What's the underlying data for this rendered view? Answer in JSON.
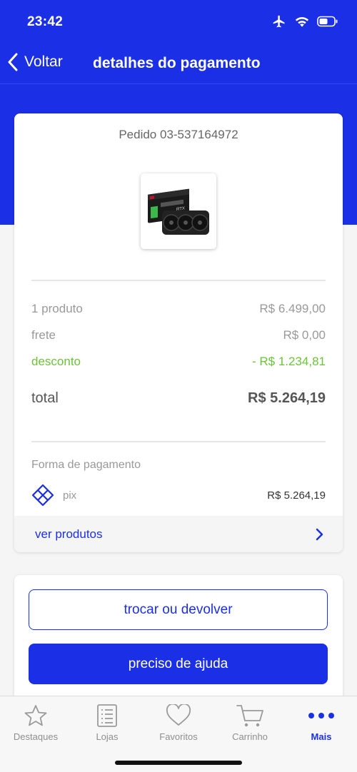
{
  "status_bar": {
    "time": "23:42"
  },
  "nav": {
    "back_label": "Voltar",
    "title": "detalhes do pagamento"
  },
  "order": {
    "id_text": "Pedido 03-537164972",
    "product_image": "graphics-card-rtx"
  },
  "summary": {
    "products_label": "1 produto",
    "products_value": "R$ 6.499,00",
    "shipping_label": "frete",
    "shipping_value": "R$ 0,00",
    "discount_label": "desconto",
    "discount_value": "- R$ 1.234,81",
    "total_label": "total",
    "total_value": "R$ 5.264,19"
  },
  "payment": {
    "label": "Forma de pagamento",
    "method": "pix",
    "amount": "R$ 5.264,19"
  },
  "ver_produtos": {
    "label": "ver produtos"
  },
  "actions": {
    "exchange_label": "trocar ou devolver",
    "help_label": "preciso de ajuda"
  },
  "tabs": [
    {
      "label": "Destaques",
      "icon": "star-icon",
      "active": false
    },
    {
      "label": "Lojas",
      "icon": "list-icon",
      "active": false
    },
    {
      "label": "Favoritos",
      "icon": "heart-icon",
      "active": false
    },
    {
      "label": "Carrinho",
      "icon": "cart-icon",
      "active": false
    },
    {
      "label": "Mais",
      "icon": "more-icon",
      "active": true
    }
  ],
  "colors": {
    "brand": "#1b2fe6",
    "discount": "#6cc33a",
    "muted": "#999999"
  }
}
